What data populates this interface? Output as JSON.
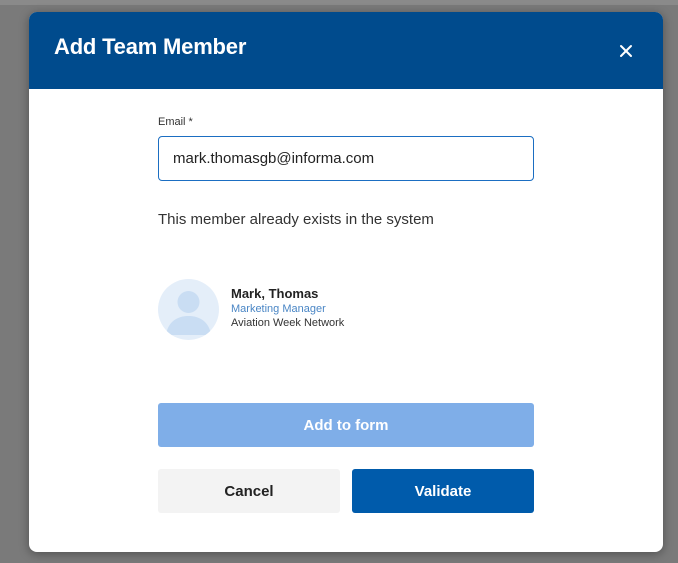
{
  "dialog": {
    "title": "Add Team Member",
    "close_icon": "close-icon"
  },
  "form": {
    "email_label": "Email *",
    "email_value": "mark.thomasgb@informa.com"
  },
  "message": "This member already exists in the system",
  "member": {
    "name": "Mark, Thomas",
    "role": "Marketing Manager",
    "organization": "Aviation Week Network",
    "avatar_icon": "person-avatar-icon"
  },
  "actions": {
    "add_label": "Add to form",
    "cancel_label": "Cancel",
    "validate_label": "Validate"
  },
  "colors": {
    "header": "#004b8d",
    "primary_button": "#005bab",
    "disabled_button": "#7faee8",
    "input_border": "#1b6ec2",
    "role_text": "#4a86c5"
  }
}
